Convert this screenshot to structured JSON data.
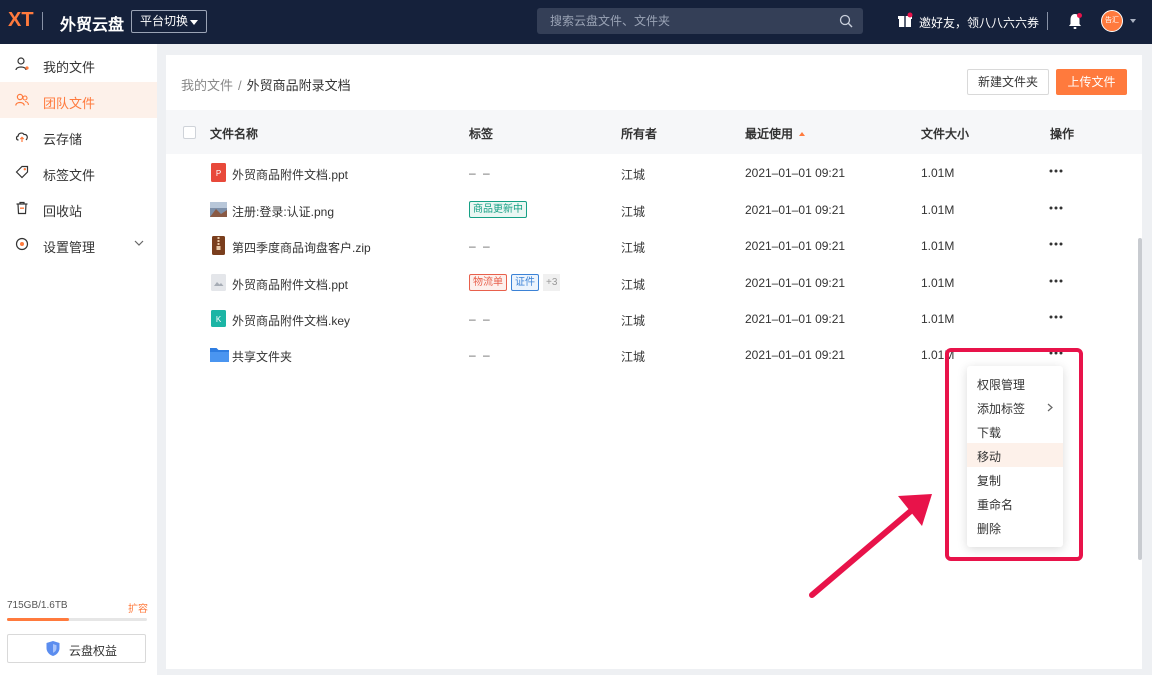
{
  "topbar": {
    "logo": "XT",
    "app_title": "外贸云盘",
    "platform_switch": "平台切换",
    "search_placeholder": "搜索云盘文件、文件夹",
    "invite_text": "邀好友，领八八六六券",
    "avatar_text": "告汇"
  },
  "sidebar": {
    "items": [
      {
        "label": "我的文件",
        "icon": "user-file-icon"
      },
      {
        "label": "团队文件",
        "icon": "team-icon",
        "active": true
      },
      {
        "label": "云存储",
        "icon": "cloud-icon"
      },
      {
        "label": "标签文件",
        "icon": "tag-icon"
      },
      {
        "label": "回收站",
        "icon": "trash-icon"
      },
      {
        "label": "设置管理",
        "icon": "settings-icon"
      }
    ],
    "storage_text": "715GB/1.6TB",
    "storage_used_fraction": 0.44,
    "expand_label": "扩容",
    "perk_label": "云盘权益"
  },
  "main": {
    "breadcrumb": {
      "root": "我的文件",
      "separator": "/",
      "current": "外贸商品附录文档"
    },
    "new_folder_label": "新建文件夹",
    "upload_label": "上传文件",
    "columns": {
      "name": "文件名称",
      "tags": "标签",
      "owner": "所有者",
      "recent": "最近使用",
      "size": "文件大小",
      "actions": "操作"
    },
    "rows": [
      {
        "name": "外贸商品附件文档.ppt",
        "icon": "ppt-icon",
        "tags": [],
        "empty": "– –",
        "owner": "江城",
        "date": "2021–01–01 09:21",
        "size": "1.01M"
      },
      {
        "name": "注册:登录:认证.png",
        "icon": "image-icon",
        "tags": [
          "商品更新中"
        ],
        "owner": "江城",
        "date": "2021–01–01 09:21",
        "size": "1.01M"
      },
      {
        "name": "第四季度商品询盘客户.zip",
        "icon": "zip-icon",
        "tags": [],
        "empty": "– –",
        "owner": "江城",
        "date": "2021–01–01 09:21",
        "size": "1.01M"
      },
      {
        "name": "外贸商品附件文档.ppt",
        "icon": "cloud-file-icon",
        "tags": [
          "物流单",
          "证件"
        ],
        "more": "+3",
        "owner": "江城",
        "date": "2021–01–01 09:21",
        "size": "1.01M"
      },
      {
        "name": "外贸商品附件文档.key",
        "icon": "key-icon",
        "tags": [],
        "empty": "– –",
        "owner": "江城",
        "date": "2021–01–01 09:21",
        "size": "1.01M"
      },
      {
        "name": "共享文件夹",
        "icon": "folder-icon",
        "tags": [],
        "empty": "– –",
        "owner": "江城",
        "date": "2021–01–01 09:21",
        "size": "1.01M"
      }
    ]
  },
  "context_menu": {
    "items": [
      "权限管理",
      "添加标签",
      "下载",
      "移动",
      "复制",
      "重命名",
      "删除"
    ],
    "hover_index": 3
  },
  "colors": {
    "accent": "#ff7a3d",
    "topbar": "#15213b",
    "highlight": "#e8134a"
  }
}
